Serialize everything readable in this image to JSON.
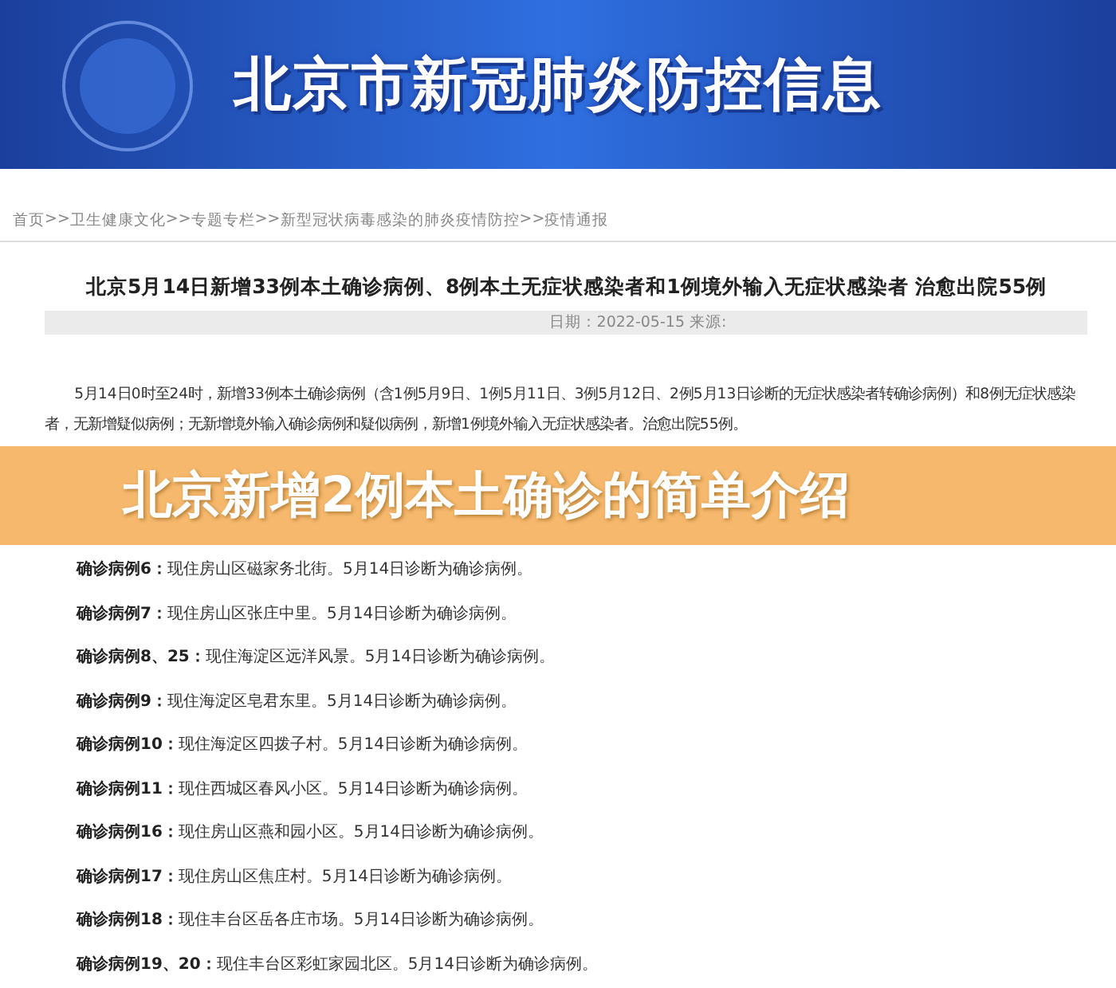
{
  "header": {
    "title": "北京市新冠肺炎防控信息"
  },
  "breadcrumb": [
    "首页",
    "卫生健康文化",
    "专题专栏",
    "新型冠状病毒感染的肺炎疫情防控",
    "疫情通报"
  ],
  "breadcrumb_separator": ">>",
  "article": {
    "title": "北京5月14日新增33例本土确诊病例、8例本土无症状感染者和1例境外输入无症状感染者 治愈出院55例",
    "date_label": "日期：",
    "date": "2022-05-15",
    "source_label": "来源:",
    "intro": "5月14日0时至24时，新增33例本土确诊病例（含1例5月9日、1例5月11日、3例5月12日、2例5月13日诊断的无症状感染者转确诊病例）和8例无症状感染者，无新增疑似病例；无新增境外输入确诊病例和疑似病例，新增1例境外输入无症状感染者。治愈出院55例。",
    "cases": [
      {
        "label": "确诊病例6：",
        "text": "现住房山区磁家务北街。5月14日诊断为确诊病例。"
      },
      {
        "label": "确诊病例7：",
        "text": "现住房山区张庄中里。5月14日诊断为确诊病例。"
      },
      {
        "label": "确诊病例8、25：",
        "text": "现住海淀区远洋风景。5月14日诊断为确诊病例。"
      },
      {
        "label": "确诊病例9：",
        "text": "现住海淀区皂君东里。5月14日诊断为确诊病例。"
      },
      {
        "label": "确诊病例10：",
        "text": "现住海淀区四拨子村。5月14日诊断为确诊病例。"
      },
      {
        "label": "确诊病例11：",
        "text": "现住西城区春风小区。5月14日诊断为确诊病例。"
      },
      {
        "label": "确诊病例16：",
        "text": "现住房山区燕和园小区。5月14日诊断为确诊病例。"
      },
      {
        "label": "确诊病例17：",
        "text": "现住房山区焦庄村。5月14日诊断为确诊病例。"
      },
      {
        "label": "确诊病例18：",
        "text": "现住丰台区岳各庄市场。5月14日诊断为确诊病例。"
      },
      {
        "label": "确诊病例19、20：",
        "text": "现住丰台区彩虹家园北区。5月14日诊断为确诊病例。"
      }
    ]
  },
  "overlay": {
    "caption": "北京新增2例本土确诊的简单介绍"
  }
}
